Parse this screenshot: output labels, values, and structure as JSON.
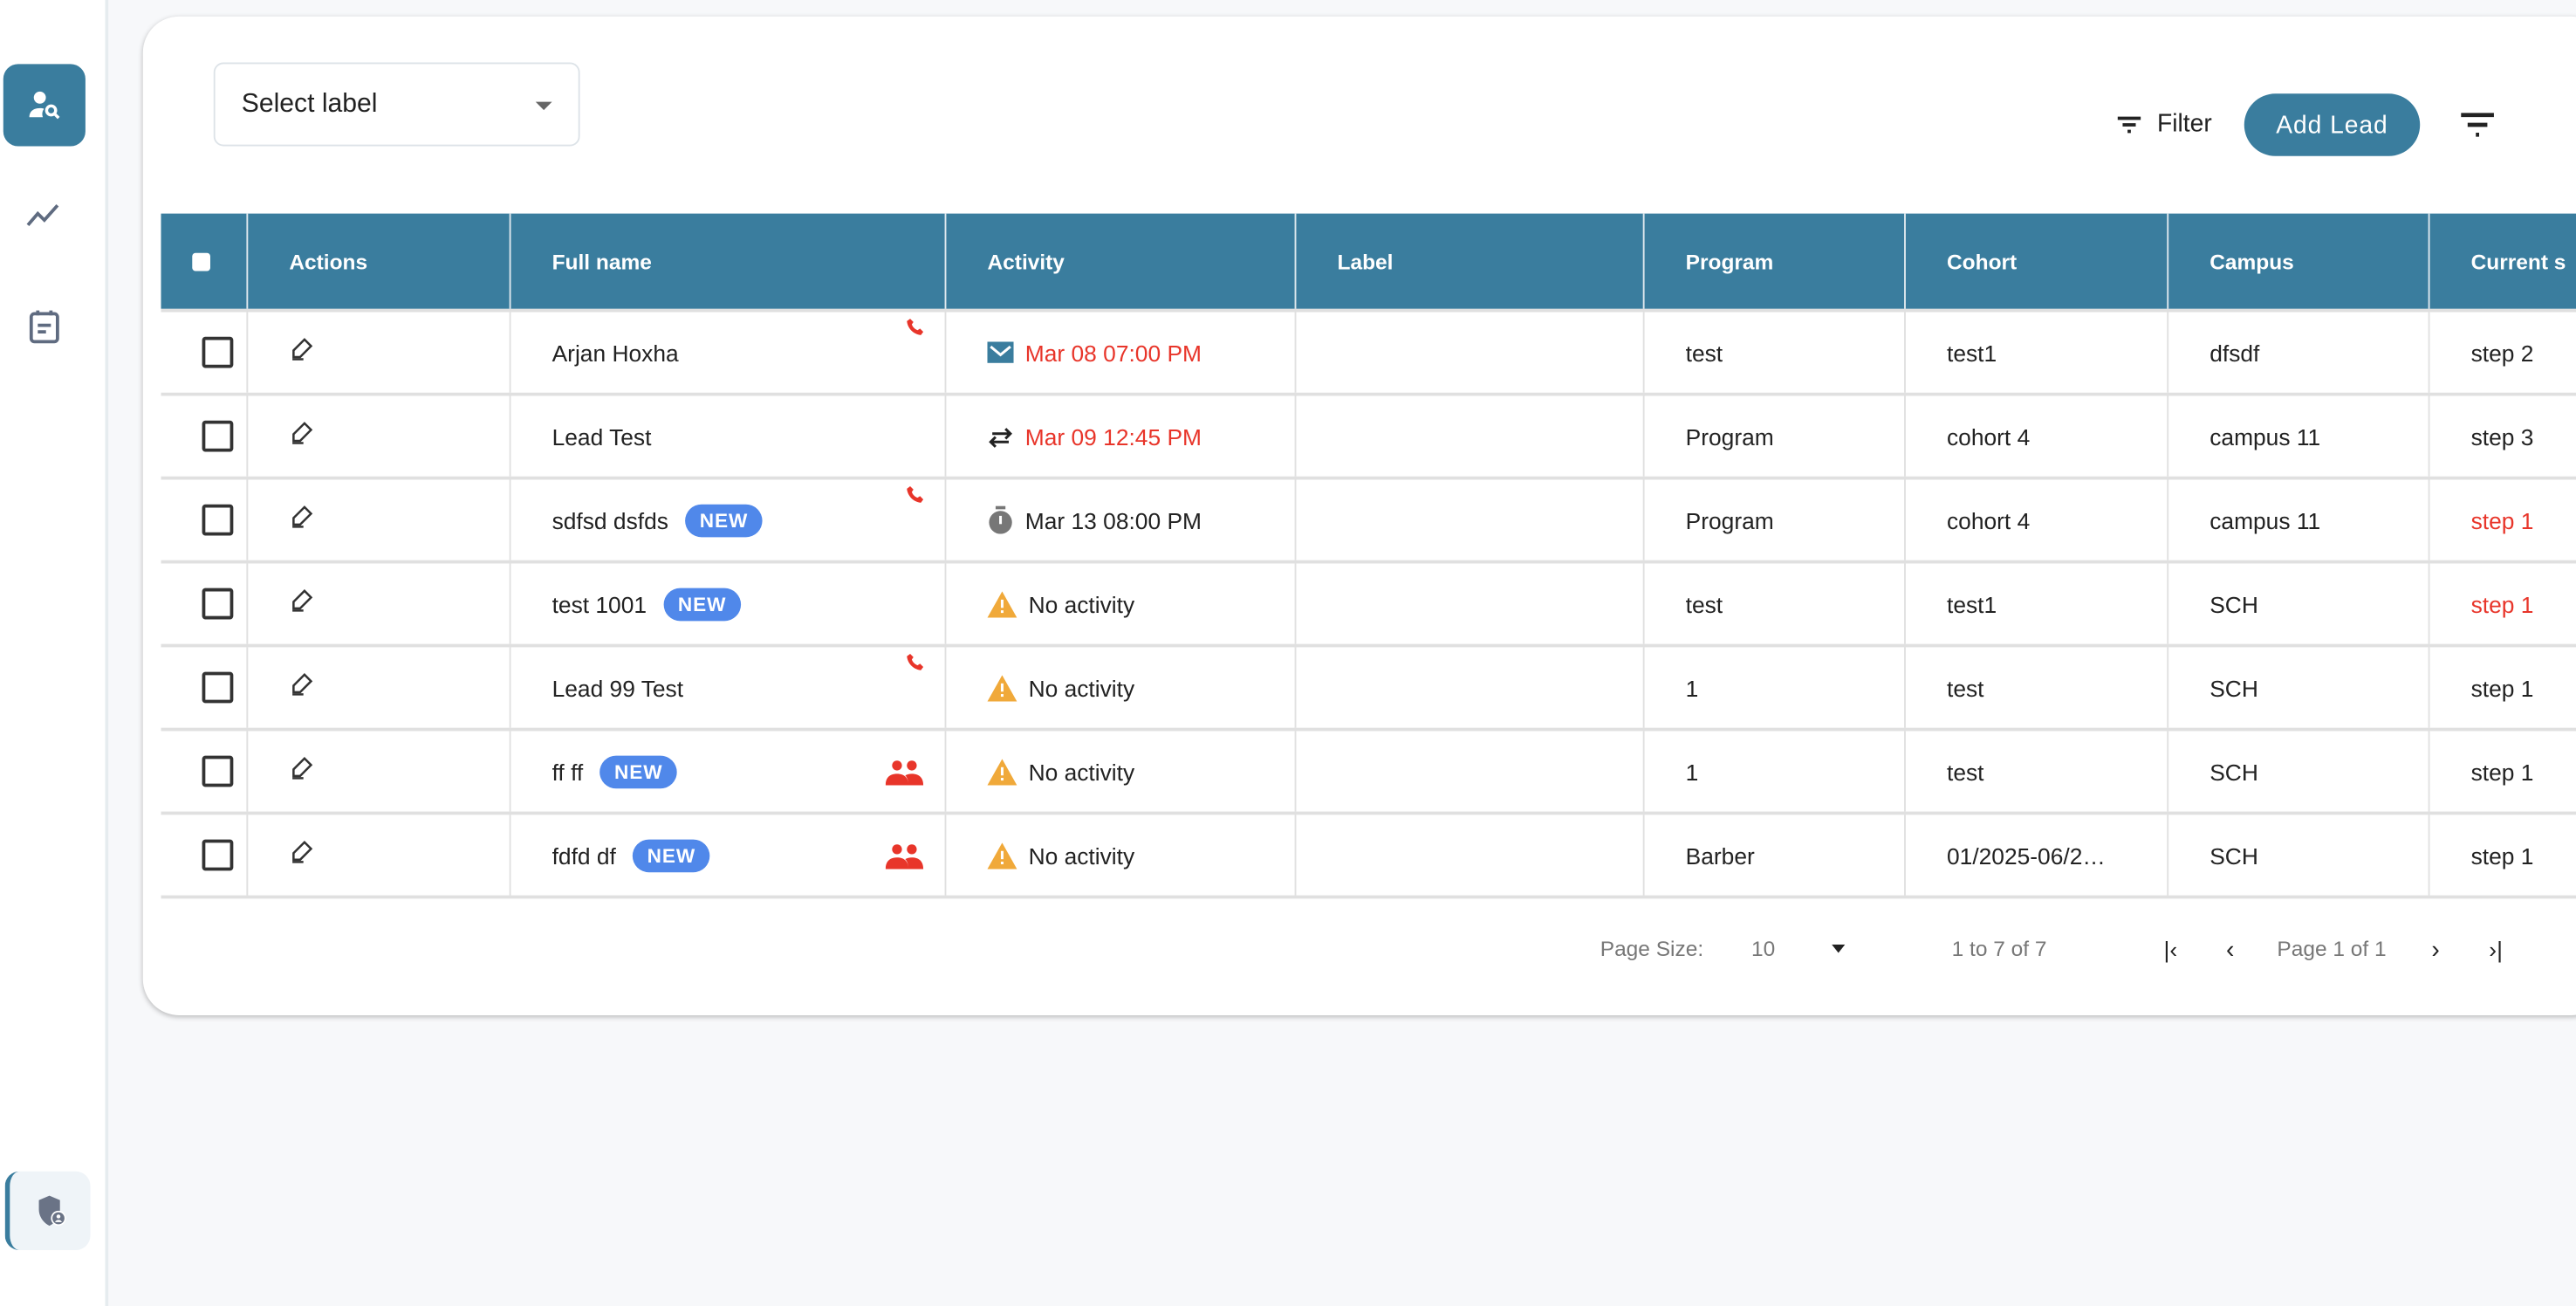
{
  "sidebar": {
    "items": [
      {
        "name": "lead-search",
        "active": true
      },
      {
        "name": "analytics"
      },
      {
        "name": "calendar"
      }
    ],
    "bottom": "admin-shield"
  },
  "toolbar": {
    "select_label": "Select label",
    "filter": "Filter",
    "add_lead": "Add Lead"
  },
  "colors": {
    "accent": "#3a7d9e",
    "badge": "#5088ea",
    "alert": "#e8352a",
    "warning": "#f0a93a"
  },
  "table": {
    "headers": [
      "Actions",
      "Full name",
      "Activity",
      "Label",
      "Program",
      "Cohort",
      "Campus",
      "Current s"
    ],
    "rows": [
      {
        "name": "Arjan Hoxha",
        "badge": "",
        "flag": "phone",
        "activity_icon": "email",
        "activity": "Mar 08 07:00 PM",
        "activity_red": true,
        "label": "",
        "program": "test",
        "cohort": "test1",
        "campus": "dfsdf",
        "step": "step 2",
        "step_red": false
      },
      {
        "name": "Lead Test",
        "badge": "",
        "flag": "",
        "activity_icon": "swap",
        "activity": "Mar 09 12:45 PM",
        "activity_red": true,
        "label": "",
        "program": "Program",
        "cohort": "cohort 4",
        "campus": "campus 11",
        "step": "step 3",
        "step_red": false
      },
      {
        "name": "sdfsd dsfds",
        "badge": "NEW",
        "flag": "phone",
        "activity_icon": "timer",
        "activity": "Mar 13 08:00 PM",
        "activity_red": false,
        "label": "",
        "program": "Program",
        "cohort": "cohort 4",
        "campus": "campus 11",
        "step": "step 1",
        "step_red": true
      },
      {
        "name": "test 1001",
        "badge": "NEW",
        "flag": "",
        "activity_icon": "warning",
        "activity": "No activity",
        "activity_red": false,
        "label": "",
        "program": "test",
        "cohort": "test1",
        "campus": "SCH",
        "step": "step 1",
        "step_red": true
      },
      {
        "name": "Lead 99 Test",
        "badge": "",
        "flag": "phone",
        "activity_icon": "warning",
        "activity": "No activity",
        "activity_red": false,
        "label": "",
        "program": "1",
        "cohort": "test",
        "campus": "SCH",
        "step": "step 1",
        "step_red": false
      },
      {
        "name": "ff ff",
        "badge": "NEW",
        "flag": "group",
        "activity_icon": "warning",
        "activity": "No activity",
        "activity_red": false,
        "label": "",
        "program": "1",
        "cohort": "test",
        "campus": "SCH",
        "step": "step 1",
        "step_red": false
      },
      {
        "name": "fdfd df",
        "badge": "NEW",
        "flag": "group",
        "activity_icon": "warning",
        "activity": "No activity",
        "activity_red": false,
        "label": "",
        "program": "Barber",
        "cohort": "01/2025-06/2…",
        "campus": "SCH",
        "step": "step 1",
        "step_red": false
      }
    ]
  },
  "pagination": {
    "page_size_label": "Page Size:",
    "page_size": "10",
    "range": "1 to 7 of 7",
    "page": "Page 1 of 1"
  }
}
